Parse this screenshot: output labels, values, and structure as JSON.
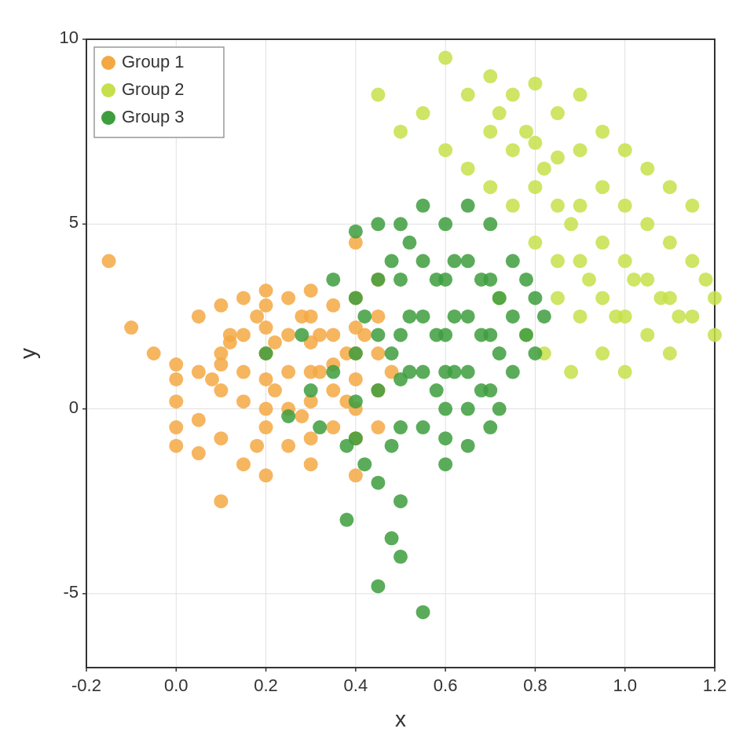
{
  "chart": {
    "title_x": "x",
    "title_y": "y",
    "x_axis": {
      "min": -0.2,
      "max": 1.2,
      "ticks": [
        -0.2,
        0.0,
        0.2,
        0.4,
        0.6,
        0.8,
        1.0,
        1.2
      ]
    },
    "y_axis": {
      "min": -7,
      "max": 10,
      "ticks": [
        -5,
        0,
        5,
        10
      ]
    },
    "legend": {
      "items": [
        {
          "label": "Group 1",
          "color": "#F4A843"
        },
        {
          "label": "Group 2",
          "color": "#C5E04A"
        },
        {
          "label": "Group 3",
          "color": "#3D9E3D"
        }
      ]
    },
    "groups": {
      "group1": {
        "color": "#F4A843",
        "points": [
          [
            -0.15,
            4.0
          ],
          [
            -0.1,
            2.2
          ],
          [
            -0.05,
            1.5
          ],
          [
            0.0,
            1.2
          ],
          [
            0.0,
            0.2
          ],
          [
            0.0,
            -0.5
          ],
          [
            0.0,
            -1.0
          ],
          [
            0.0,
            0.8
          ],
          [
            0.05,
            2.5
          ],
          [
            0.05,
            1.0
          ],
          [
            0.05,
            -0.3
          ],
          [
            0.05,
            -1.2
          ],
          [
            0.1,
            2.8
          ],
          [
            0.1,
            1.5
          ],
          [
            0.1,
            0.5
          ],
          [
            0.1,
            -0.8
          ],
          [
            0.1,
            -2.5
          ],
          [
            0.12,
            1.8
          ],
          [
            0.15,
            3.0
          ],
          [
            0.15,
            2.0
          ],
          [
            0.15,
            1.0
          ],
          [
            0.15,
            0.2
          ],
          [
            0.15,
            -1.5
          ],
          [
            0.18,
            2.5
          ],
          [
            0.2,
            3.2
          ],
          [
            0.2,
            2.8
          ],
          [
            0.2,
            2.2
          ],
          [
            0.2,
            1.5
          ],
          [
            0.2,
            0.8
          ],
          [
            0.2,
            0.0
          ],
          [
            0.2,
            -0.5
          ],
          [
            0.2,
            -1.8
          ],
          [
            0.22,
            1.8
          ],
          [
            0.25,
            3.0
          ],
          [
            0.25,
            2.0
          ],
          [
            0.25,
            1.0
          ],
          [
            0.25,
            0.0
          ],
          [
            0.25,
            -1.0
          ],
          [
            0.28,
            2.5
          ],
          [
            0.3,
            3.2
          ],
          [
            0.3,
            2.5
          ],
          [
            0.3,
            1.8
          ],
          [
            0.3,
            1.0
          ],
          [
            0.3,
            0.2
          ],
          [
            0.3,
            -0.8
          ],
          [
            0.3,
            -1.5
          ],
          [
            0.32,
            2.0
          ],
          [
            0.35,
            2.8
          ],
          [
            0.35,
            2.0
          ],
          [
            0.35,
            1.2
          ],
          [
            0.35,
            0.5
          ],
          [
            0.35,
            -0.5
          ],
          [
            0.38,
            1.5
          ],
          [
            0.4,
            4.5
          ],
          [
            0.4,
            3.0
          ],
          [
            0.4,
            2.2
          ],
          [
            0.4,
            1.5
          ],
          [
            0.4,
            0.8
          ],
          [
            0.4,
            0.0
          ],
          [
            0.4,
            -0.8
          ],
          [
            0.4,
            -1.8
          ],
          [
            0.42,
            2.0
          ],
          [
            0.45,
            3.5
          ],
          [
            0.45,
            2.5
          ],
          [
            0.45,
            1.5
          ],
          [
            0.45,
            0.5
          ],
          [
            0.45,
            -0.5
          ],
          [
            0.48,
            1.0
          ],
          [
            0.1,
            1.2
          ],
          [
            0.22,
            0.5
          ],
          [
            0.28,
            -0.2
          ],
          [
            0.18,
            -1.0
          ],
          [
            0.08,
            0.8
          ],
          [
            0.12,
            2.0
          ],
          [
            0.32,
            1.0
          ],
          [
            0.38,
            0.2
          ]
        ]
      },
      "group2": {
        "color": "#C5E04A",
        "points": [
          [
            0.45,
            8.5
          ],
          [
            0.5,
            7.5
          ],
          [
            0.55,
            8.0
          ],
          [
            0.6,
            9.5
          ],
          [
            0.6,
            7.0
          ],
          [
            0.65,
            8.5
          ],
          [
            0.65,
            6.5
          ],
          [
            0.7,
            9.0
          ],
          [
            0.7,
            7.5
          ],
          [
            0.7,
            6.0
          ],
          [
            0.72,
            8.0
          ],
          [
            0.75,
            8.5
          ],
          [
            0.75,
            7.0
          ],
          [
            0.75,
            5.5
          ],
          [
            0.78,
            7.5
          ],
          [
            0.8,
            8.8
          ],
          [
            0.8,
            7.2
          ],
          [
            0.8,
            6.0
          ],
          [
            0.8,
            4.5
          ],
          [
            0.82,
            6.5
          ],
          [
            0.85,
            8.0
          ],
          [
            0.85,
            6.8
          ],
          [
            0.85,
            5.5
          ],
          [
            0.85,
            4.0
          ],
          [
            0.85,
            3.0
          ],
          [
            0.88,
            5.0
          ],
          [
            0.9,
            8.5
          ],
          [
            0.9,
            7.0
          ],
          [
            0.9,
            5.5
          ],
          [
            0.9,
            4.0
          ],
          [
            0.9,
            2.5
          ],
          [
            0.92,
            3.5
          ],
          [
            0.95,
            7.5
          ],
          [
            0.95,
            6.0
          ],
          [
            0.95,
            4.5
          ],
          [
            0.95,
            3.0
          ],
          [
            0.95,
            1.5
          ],
          [
            0.98,
            2.5
          ],
          [
            1.0,
            7.0
          ],
          [
            1.0,
            5.5
          ],
          [
            1.0,
            4.0
          ],
          [
            1.0,
            2.5
          ],
          [
            1.0,
            1.0
          ],
          [
            1.02,
            3.5
          ],
          [
            1.05,
            6.5
          ],
          [
            1.05,
            5.0
          ],
          [
            1.05,
            3.5
          ],
          [
            1.05,
            2.0
          ],
          [
            1.08,
            3.0
          ],
          [
            1.1,
            6.0
          ],
          [
            1.1,
            4.5
          ],
          [
            1.1,
            3.0
          ],
          [
            1.1,
            1.5
          ],
          [
            1.12,
            2.5
          ],
          [
            1.15,
            5.5
          ],
          [
            1.15,
            4.0
          ],
          [
            1.15,
            2.5
          ],
          [
            1.18,
            3.5
          ],
          [
            1.2,
            3.0
          ],
          [
            1.2,
            2.0
          ],
          [
            0.72,
            3.0
          ],
          [
            0.78,
            2.0
          ],
          [
            0.82,
            1.5
          ],
          [
            0.88,
            1.0
          ]
        ]
      },
      "group3": {
        "color": "#3D9E3D",
        "points": [
          [
            0.2,
            1.5
          ],
          [
            0.25,
            -0.2
          ],
          [
            0.28,
            2.0
          ],
          [
            0.3,
            0.5
          ],
          [
            0.32,
            -0.5
          ],
          [
            0.35,
            3.5
          ],
          [
            0.35,
            1.0
          ],
          [
            0.38,
            -1.0
          ],
          [
            0.4,
            4.8
          ],
          [
            0.4,
            3.0
          ],
          [
            0.4,
            1.5
          ],
          [
            0.4,
            0.2
          ],
          [
            0.4,
            -0.8
          ],
          [
            0.42,
            2.5
          ],
          [
            0.42,
            -1.5
          ],
          [
            0.45,
            5.0
          ],
          [
            0.45,
            3.5
          ],
          [
            0.45,
            2.0
          ],
          [
            0.45,
            0.5
          ],
          [
            0.45,
            -2.0
          ],
          [
            0.48,
            4.0
          ],
          [
            0.48,
            1.5
          ],
          [
            0.48,
            -1.0
          ],
          [
            0.5,
            5.0
          ],
          [
            0.5,
            3.5
          ],
          [
            0.5,
            2.0
          ],
          [
            0.5,
            0.8
          ],
          [
            0.5,
            -0.5
          ],
          [
            0.5,
            -2.5
          ],
          [
            0.52,
            4.5
          ],
          [
            0.52,
            2.5
          ],
          [
            0.52,
            1.0
          ],
          [
            0.55,
            5.5
          ],
          [
            0.55,
            4.0
          ],
          [
            0.55,
            2.5
          ],
          [
            0.55,
            1.0
          ],
          [
            0.55,
            -0.5
          ],
          [
            0.55,
            -5.5
          ],
          [
            0.58,
            3.5
          ],
          [
            0.58,
            2.0
          ],
          [
            0.58,
            0.5
          ],
          [
            0.6,
            5.0
          ],
          [
            0.6,
            3.5
          ],
          [
            0.6,
            2.0
          ],
          [
            0.6,
            1.0
          ],
          [
            0.6,
            0.0
          ],
          [
            0.6,
            -0.8
          ],
          [
            0.6,
            -1.5
          ],
          [
            0.62,
            4.0
          ],
          [
            0.62,
            2.5
          ],
          [
            0.62,
            1.0
          ],
          [
            0.65,
            5.5
          ],
          [
            0.65,
            4.0
          ],
          [
            0.65,
            2.5
          ],
          [
            0.65,
            1.0
          ],
          [
            0.65,
            0.0
          ],
          [
            0.65,
            -1.0
          ],
          [
            0.68,
            3.5
          ],
          [
            0.68,
            2.0
          ],
          [
            0.68,
            0.5
          ],
          [
            0.7,
            5.0
          ],
          [
            0.7,
            3.5
          ],
          [
            0.7,
            2.0
          ],
          [
            0.7,
            0.5
          ],
          [
            0.7,
            -0.5
          ],
          [
            0.72,
            3.0
          ],
          [
            0.72,
            1.5
          ],
          [
            0.72,
            0.0
          ],
          [
            0.75,
            4.0
          ],
          [
            0.75,
            2.5
          ],
          [
            0.75,
            1.0
          ],
          [
            0.78,
            3.5
          ],
          [
            0.78,
            2.0
          ],
          [
            0.8,
            3.0
          ],
          [
            0.8,
            1.5
          ],
          [
            0.82,
            2.5
          ],
          [
            0.38,
            -3.0
          ],
          [
            0.45,
            -4.8
          ],
          [
            0.5,
            -4.0
          ],
          [
            0.48,
            -3.5
          ]
        ]
      }
    }
  }
}
